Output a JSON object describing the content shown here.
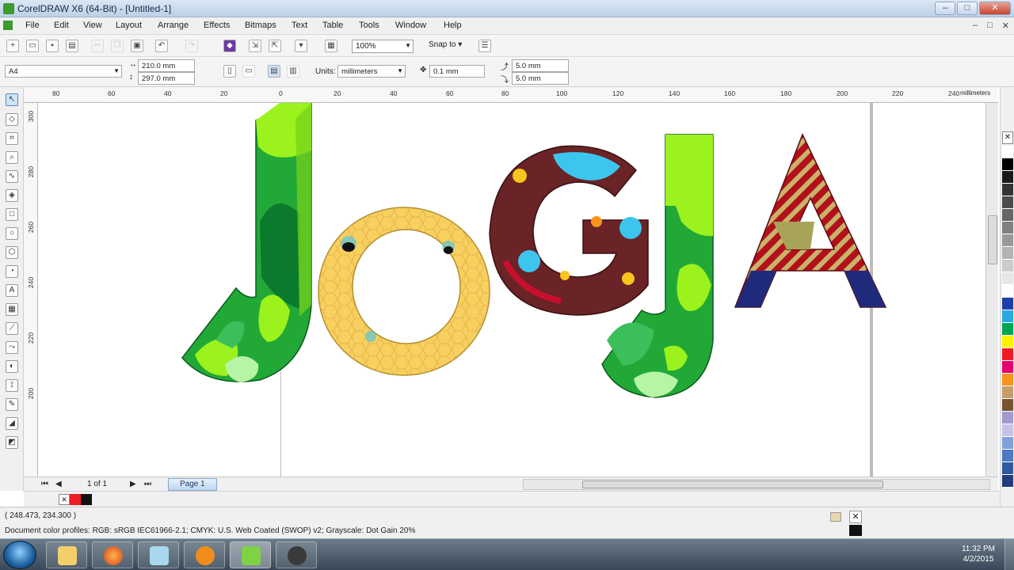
{
  "window": {
    "title": "CorelDRAW X6 (64-Bit) - [Untitled-1]",
    "minimize": "–",
    "maximize": "□",
    "close": "✕"
  },
  "menu": [
    "File",
    "Edit",
    "View",
    "Layout",
    "Arrange",
    "Effects",
    "Bitmaps",
    "Text",
    "Table",
    "Tools",
    "Window",
    "Help"
  ],
  "mdi_buttons": [
    "–",
    "□",
    "✕"
  ],
  "toolbar": {
    "zoom": "100%",
    "snap_to": "Snap to"
  },
  "property_bar": {
    "paper_size": "A4",
    "width": "210.0 mm",
    "height": "297.0 mm",
    "units_label": "Units:",
    "units": "millimeters",
    "nudge": "0.1 mm",
    "dup_x": "5.0 mm",
    "dup_y": "5.0 mm"
  },
  "ruler": {
    "h_ticks": [
      "80",
      "60",
      "40",
      "20",
      "0",
      "20",
      "40",
      "60",
      "80",
      "100",
      "120",
      "140",
      "160",
      "180",
      "200",
      "220",
      "240"
    ],
    "unit": "millimeters",
    "v_ticks": [
      "300",
      "280",
      "260",
      "240",
      "220",
      "200"
    ]
  },
  "artwork": {
    "letters": [
      "J",
      "O",
      "G",
      "J",
      "A"
    ],
    "colors": {
      "green_light": "#9bf21c",
      "green_mid": "#22a836",
      "green_dark": "#0b7a2c",
      "honey": "#f7d060",
      "maroon": "#6a2326",
      "sky": "#3cc6ee",
      "red": "#c8102e",
      "navy": "#1f2a7a",
      "olive": "#a7a45a"
    }
  },
  "page_nav": {
    "count": "1 of 1",
    "page_tab": "Page 1"
  },
  "status": {
    "cursor_pos": "( 248.473, 234.300 )",
    "color_profiles": "Document color profiles: RGB: sRGB IEC61966-2.1; CMYK: U.S. Web Coated (SWOP) v2; Grayscale: Dot Gain 20%"
  },
  "taskbar": {
    "apps": [
      "windows-explorer",
      "firefox",
      "notepad",
      "avast",
      "coreldraw",
      "media-app"
    ],
    "time": "11:32 PM",
    "date": "4/2/2015"
  },
  "palette_colors": [
    "#ffffff",
    "#000000",
    "#1a1a1a",
    "#333333",
    "#4d4d4d",
    "#666666",
    "#808080",
    "#999999",
    "#b3b3b3",
    "#cccccc",
    "#e6e6e6",
    "#ffffff",
    "#1f3fa8",
    "#2aa9e0",
    "#00a651",
    "#fff200",
    "#ed1c24",
    "#e8006f",
    "#f7941d",
    "#c69c6d",
    "#7a5230",
    "#a39ad0",
    "#c8c3e6",
    "#7fa3d8",
    "#4d7ac0",
    "#2e5aa0",
    "#233a7d"
  ]
}
